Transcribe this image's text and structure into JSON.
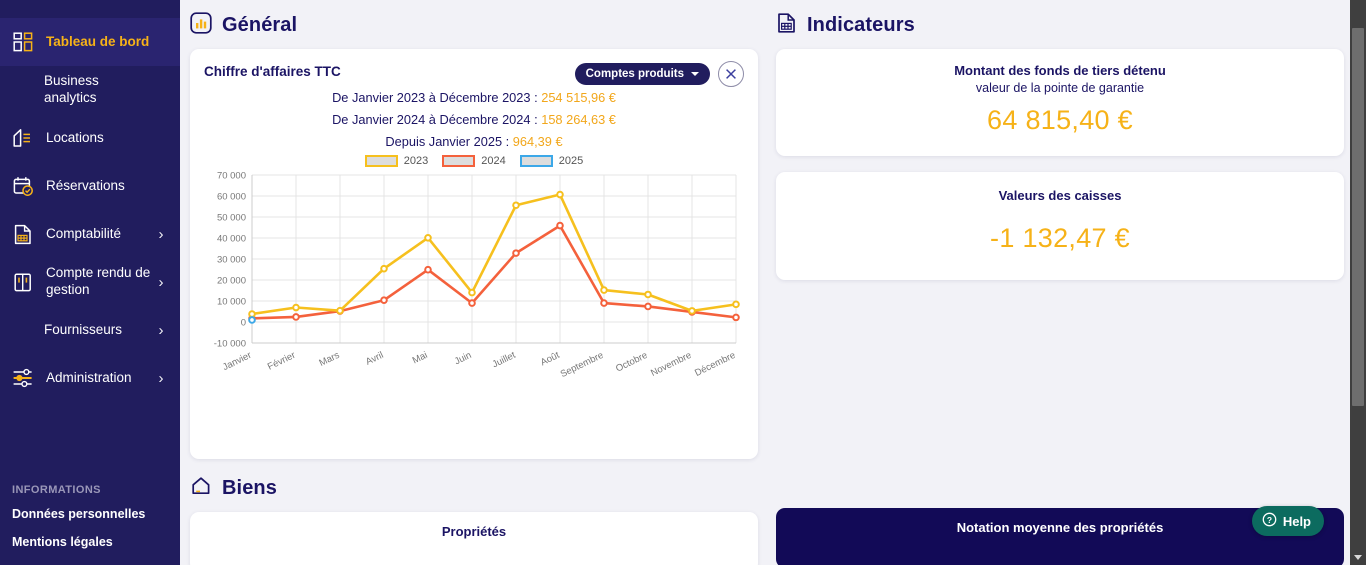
{
  "sidebar": {
    "items": [
      {
        "label": "Tableau de bord",
        "icon": "dashboard-grid-icon",
        "active": true,
        "chevron": false,
        "has_icon": true
      },
      {
        "label": "Business analytics",
        "icon": "",
        "active": false,
        "chevron": false,
        "has_icon": false
      },
      {
        "label": "Locations",
        "icon": "house-lines-icon",
        "active": false,
        "chevron": false,
        "has_icon": true
      },
      {
        "label": "Réservations",
        "icon": "calendar-check-icon",
        "active": false,
        "chevron": false,
        "has_icon": true
      },
      {
        "label": "Comptabilité",
        "icon": "document-grid-icon",
        "active": false,
        "chevron": true,
        "has_icon": true
      },
      {
        "label": "Compte rendu de gestion",
        "icon": "book-icon",
        "active": false,
        "chevron": true,
        "has_icon": true
      },
      {
        "label": "Fournisseurs",
        "icon": "",
        "active": false,
        "chevron": true,
        "has_icon": false
      },
      {
        "label": "Administration",
        "icon": "sliders-icon",
        "active": false,
        "chevron": true,
        "has_icon": true
      }
    ],
    "info_title": "INFORMATIONS",
    "links": [
      "Données personnelles",
      "Mentions légales"
    ]
  },
  "general": {
    "section_title": "Général",
    "section_icon": "bar-chart-box-icon",
    "chart_card": {
      "title": "Chiffre d'affaires TTC",
      "dropdown_label": "Comptes produits",
      "close_icon": "close-circle-icon",
      "summaries": [
        {
          "label": "De Janvier 2023 à Décembre 2023 : ",
          "amount": "254 515,96 €"
        },
        {
          "label": "De Janvier 2024 à Décembre 2024 : ",
          "amount": "158 264,63 €"
        },
        {
          "label": "Depuis Janvier 2025 : ",
          "amount": "964,39 €"
        }
      ]
    }
  },
  "indicateurs": {
    "section_title": "Indicateurs",
    "section_icon": "report-document-icon",
    "cards": [
      {
        "title_line1": "Montant des fonds de tiers détenu",
        "title_line2": "valeur de la pointe de garantie",
        "value": "64 815,40 €"
      },
      {
        "title_line1": "Valeurs des caisses",
        "title_line2": "",
        "value": "-1 132,47 €"
      }
    ]
  },
  "biens": {
    "section_title": "Biens",
    "section_icon": "house-outline-icon",
    "properties_card_title": "Propriétés",
    "rating_card_title": "Notation moyenne des propriétés"
  },
  "help": {
    "label": "Help",
    "icon": "question-circle-icon"
  },
  "colors": {
    "sidebar_bg": "#211d5e",
    "accent_yellow": "#f6b218",
    "navy": "#1b1464",
    "series_2023": "#f6c01e",
    "series_2024": "#f4613c",
    "series_2025": "#3ca8e8",
    "help_green": "#0c6b5f",
    "page_bg": "#f2f2f7"
  },
  "chart_data": {
    "type": "line",
    "title": "Chiffre d'affaires TTC",
    "xlabel": "",
    "ylabel": "",
    "ylim": [
      -10000,
      70000
    ],
    "yticks": [
      -10000,
      0,
      10000,
      20000,
      30000,
      40000,
      50000,
      60000,
      70000
    ],
    "ytick_labels": [
      "-10 000",
      "0",
      "10 000",
      "20 000",
      "30 000",
      "40 000",
      "50 000",
      "60 000",
      "70 000"
    ],
    "grid": true,
    "legend_position": "top-center",
    "categories": [
      "Janvier",
      "Février",
      "Mars",
      "Avril",
      "Mai",
      "Juin",
      "Juillet",
      "Août",
      "Septembre",
      "Octobre",
      "Novembre",
      "Décembre"
    ],
    "series": [
      {
        "name": "2023",
        "color": "#f6c01e",
        "values": [
          3800,
          6900,
          5400,
          25400,
          40100,
          14000,
          55600,
          60700,
          15200,
          13100,
          5300,
          8400
        ]
      },
      {
        "name": "2024",
        "color": "#f4613c",
        "values": [
          1700,
          2400,
          5200,
          10400,
          24900,
          9000,
          32800,
          45900,
          9000,
          7400,
          4800,
          2200
        ]
      },
      {
        "name": "2025",
        "color": "#3ca8e8",
        "values": [
          964,
          null,
          null,
          null,
          null,
          null,
          null,
          null,
          null,
          null,
          null,
          null
        ]
      }
    ]
  }
}
